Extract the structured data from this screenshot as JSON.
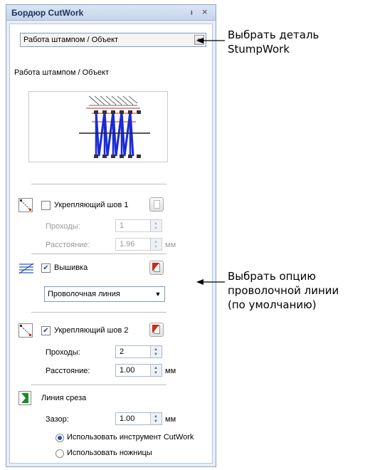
{
  "panel": {
    "title": "Бордюр CutWork",
    "pin_glyph": "ᵻ",
    "close_glyph": "×",
    "mode_select": {
      "value": "Работа штампом / Объект"
    },
    "section_label": "Работа штампом / Объект",
    "stitch1": {
      "label": "Укрепляющий шов 1",
      "checked": false,
      "passes_label": "Проходы:",
      "passes": "1",
      "distance_label": "Расстояние:",
      "distance": "1.96",
      "unit": "мм"
    },
    "embroidery": {
      "label": "Вышивка",
      "checked": true,
      "type_select": {
        "value": "Проволочная линия"
      }
    },
    "stitch2": {
      "label": "Укрепляющий шов 2",
      "checked": true,
      "passes_label": "Проходы:",
      "passes": "2",
      "distance_label": "Расстояние:",
      "distance": "1.00",
      "unit": "мм"
    },
    "cut_line": {
      "label": "Линия среза",
      "gap_label": "Зазор:",
      "gap": "1.00",
      "unit": "мм",
      "options": [
        {
          "label": "Использовать инструмент CutWork",
          "selected": true
        },
        {
          "label": "Использовать ножницы",
          "selected": false
        }
      ]
    }
  },
  "callouts": {
    "top": [
      "Выбрать деталь",
      "StumpWork"
    ],
    "middle": [
      "Выбрать опцию",
      "проволочной линии",
      "(по умолчанию)"
    ]
  },
  "colors": {
    "panel_bg": "#e8eef7",
    "title_text": "#1d3560",
    "stitch_blue": "#1a2bd6",
    "accent_red": "#cc2a1a"
  }
}
